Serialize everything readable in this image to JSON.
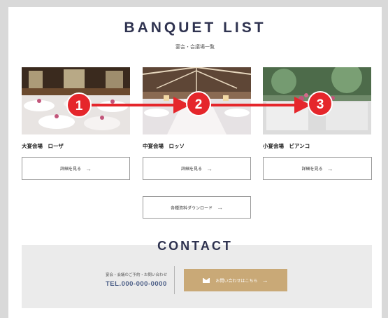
{
  "header": {
    "title": "BANQUET LIST",
    "subtitle": "宴会・会議場一覧"
  },
  "venues": [
    {
      "name": "大宴会場　ローザ",
      "button_label": "詳細を見る",
      "marker": "1"
    },
    {
      "name": "中宴会場　ロッソ",
      "button_label": "詳細を見る",
      "marker": "2"
    },
    {
      "name": "小宴会場　ビアンコ",
      "button_label": "詳細を見る",
      "marker": "3"
    }
  ],
  "download": {
    "button_label": "各種資料ダウンロード"
  },
  "contact": {
    "title": "CONTACT",
    "label": "宴会・会議のご予約・お問い合わせ",
    "tel": "TEL.000-000-0000",
    "button_label": "お問い合わせはこちら"
  },
  "colors": {
    "marker_red": "#e5262b",
    "heading": "#2f3350",
    "accent_gold": "#c9a977",
    "contact_bg": "#ebebeb"
  },
  "icons": {
    "arrow": "→",
    "mail": "mail-icon"
  }
}
